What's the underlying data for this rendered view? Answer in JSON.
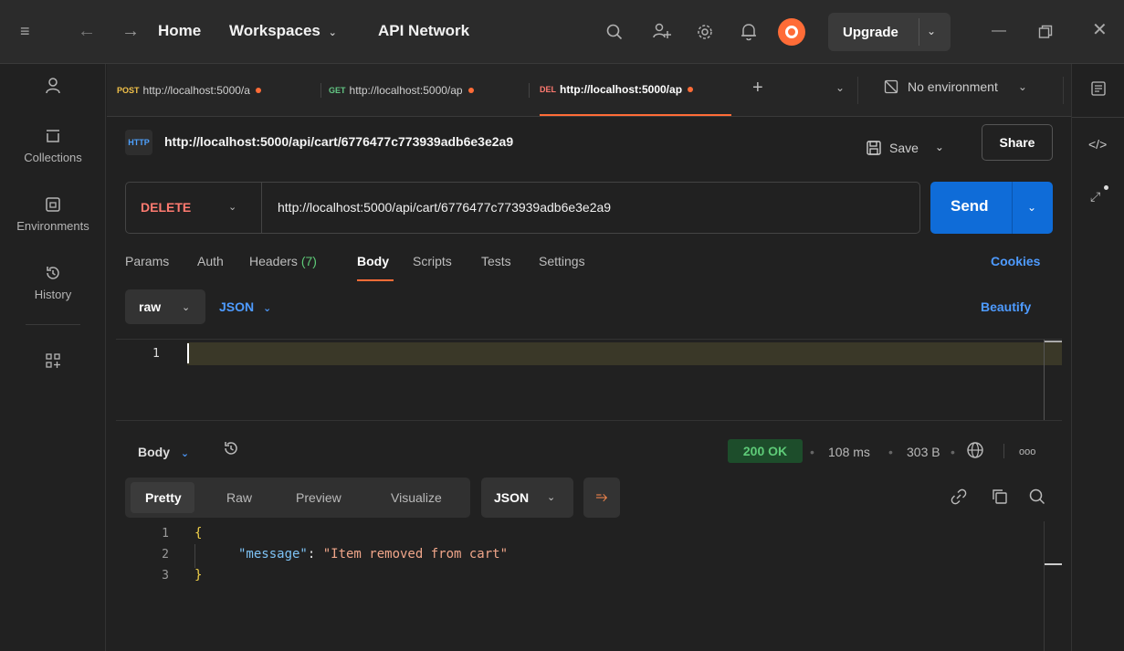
{
  "topbar": {
    "nav": {
      "home": "Home",
      "workspaces": "Workspaces",
      "api_network": "API Network"
    },
    "upgrade_label": "Upgrade"
  },
  "sidebar": {
    "items": [
      {
        "label": "Collections",
        "icon": "collections-icon"
      },
      {
        "label": "Environments",
        "icon": "environments-icon"
      },
      {
        "label": "History",
        "icon": "history-icon"
      }
    ]
  },
  "tabs": [
    {
      "method": "POST",
      "method_color": "#f3c24a",
      "url": "http://localhost:5000/a",
      "dirty": true
    },
    {
      "method": "GET",
      "method_color": "#63c784",
      "url": "http://localhost:5000/ap",
      "dirty": true
    },
    {
      "method": "DEL",
      "method_color": "#ff7a70",
      "url": "http://localhost:5000/ap",
      "dirty": true,
      "active": true
    }
  ],
  "environment": {
    "selected": "No environment"
  },
  "request": {
    "title": "http://localhost:5000/api/cart/6776477c773939adb6e3e2a9",
    "badge": "HTTP",
    "save_label": "Save",
    "share_label": "Share",
    "method": "DELETE",
    "url": "http://localhost:5000/api/cart/6776477c773939adb6e3e2a9",
    "send_label": "Send",
    "subtabs": {
      "params": "Params",
      "auth": "Auth",
      "headers": "Headers",
      "headers_count": "(7)",
      "body": "Body",
      "scripts": "Scripts",
      "tests": "Tests",
      "settings": "Settings"
    },
    "cookies_label": "Cookies",
    "body_mode": "raw",
    "body_language": "JSON",
    "beautify_label": "Beautify",
    "editor_line": "1"
  },
  "response": {
    "section_label": "Body",
    "status": "200 OK",
    "time": "108 ms",
    "size": "303 B",
    "more": "ooo",
    "tabs": {
      "pretty": "Pretty",
      "raw": "Raw",
      "preview": "Preview",
      "visualize": "Visualize"
    },
    "format": "JSON",
    "lines": [
      "1",
      "2",
      "3"
    ],
    "json": {
      "open": "{",
      "key": "\"message\"",
      "colon": ": ",
      "value": "\"Item removed from cart\"",
      "close": "}"
    }
  },
  "colors": {
    "accent": "#ff6c37",
    "send": "#0f6cd8",
    "delete": "#ff7a70",
    "status_ok": "#5ecb78"
  }
}
